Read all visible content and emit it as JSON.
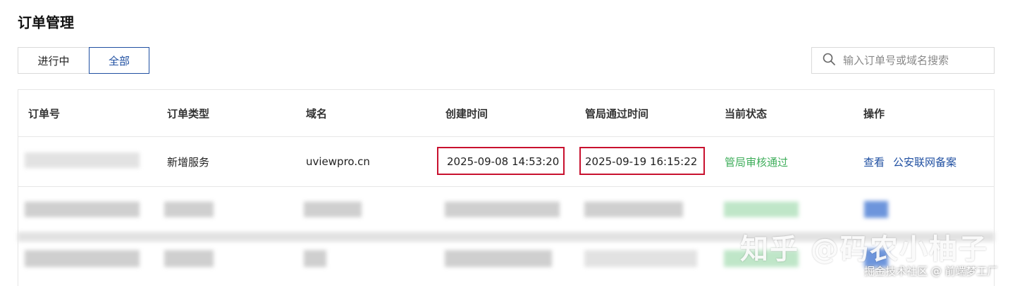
{
  "page": {
    "title": "订单管理"
  },
  "tabs": [
    {
      "label": "进行中",
      "active": false
    },
    {
      "label": "全部",
      "active": true
    }
  ],
  "search": {
    "placeholder": "输入订单号或域名搜索",
    "icon": "search-icon"
  },
  "table": {
    "columns": [
      "订单号",
      "订单类型",
      "域名",
      "创建时间",
      "管局通过时间",
      "当前状态",
      "操作"
    ],
    "rows": [
      {
        "order_type": "新增服务",
        "domain": "uviewpro.cn",
        "created_at": "2025-09-08 14:53:20",
        "approved_at": "2025-09-19 16:15:22",
        "status": "管局审核通过",
        "actions": [
          "查看",
          "公安联网备案"
        ]
      }
    ]
  },
  "colors": {
    "accent": "#1f4fa1",
    "success": "#3fae5b",
    "highlight": "#c8102e"
  },
  "watermark": {
    "text": "知乎 @码农小柚子",
    "credit": "掘金技术社区 @ 前端梦工厂"
  }
}
